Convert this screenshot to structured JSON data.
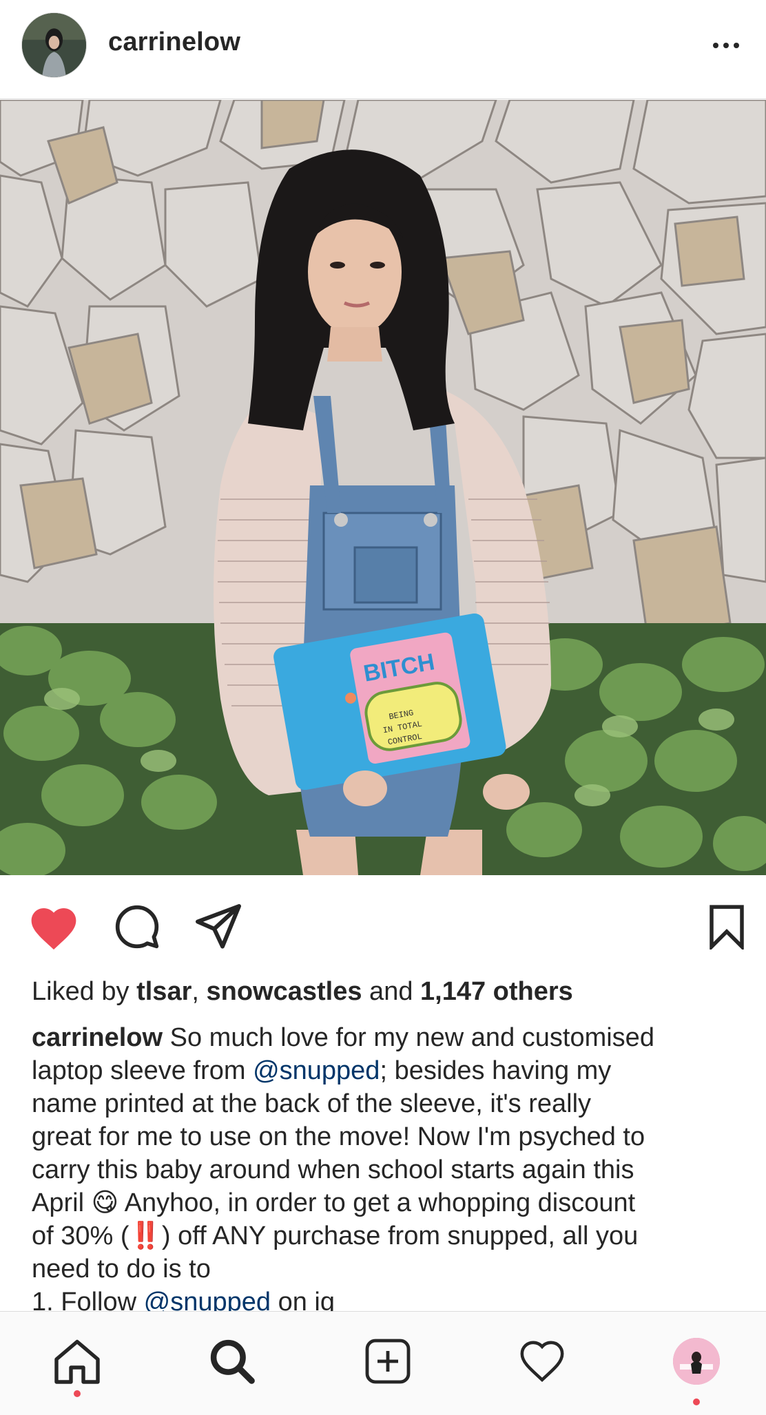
{
  "post": {
    "username": "carrinelow",
    "more_icon": "more-horizontal-icon",
    "liked": true,
    "colors": {
      "like_red": "#ed4956",
      "mention_blue": "#003569",
      "text": "#262626",
      "divider": "#dbdbdb"
    }
  },
  "likes": {
    "prefix": "Liked by ",
    "user1": "tlsar",
    "sep": ", ",
    "user2": "snowcastles",
    "and": " and ",
    "others": "1,147 others"
  },
  "caption": {
    "username": "carrinelow",
    "line1_rest": " So much love for my new and customised",
    "line2_pre": "laptop sleeve from ",
    "mention": "@snupped",
    "line2_post": "; besides having my",
    "line3": "name printed at the back of the sleeve, it's really",
    "line4": "great for me to use on the move! Now I'm psyched to",
    "line5": "carry this baby around when school starts again this",
    "line6_pre": "April ",
    "emoji_yum": "😋",
    "line6_post": " Anyhoo, in order to get a whopping discount",
    "line7_pre": "of 30% (",
    "emoji_exclaim": "‼️",
    "line7_post": ") off ANY purchase from snupped, all you",
    "line8": "need to do is to",
    "line9_pre": "1. Follow ",
    "line9_mention": "@snupped",
    "line9_post": " on ig"
  },
  "tabbar": {
    "items": [
      {
        "name": "home",
        "icon": "home-icon",
        "dot": true
      },
      {
        "name": "search",
        "icon": "search-icon",
        "dot": false
      },
      {
        "name": "new-post",
        "icon": "plus-square-icon",
        "dot": false
      },
      {
        "name": "activity",
        "icon": "heart-outline-icon",
        "dot": false
      },
      {
        "name": "profile",
        "icon": "profile-avatar",
        "dot": true
      }
    ]
  }
}
